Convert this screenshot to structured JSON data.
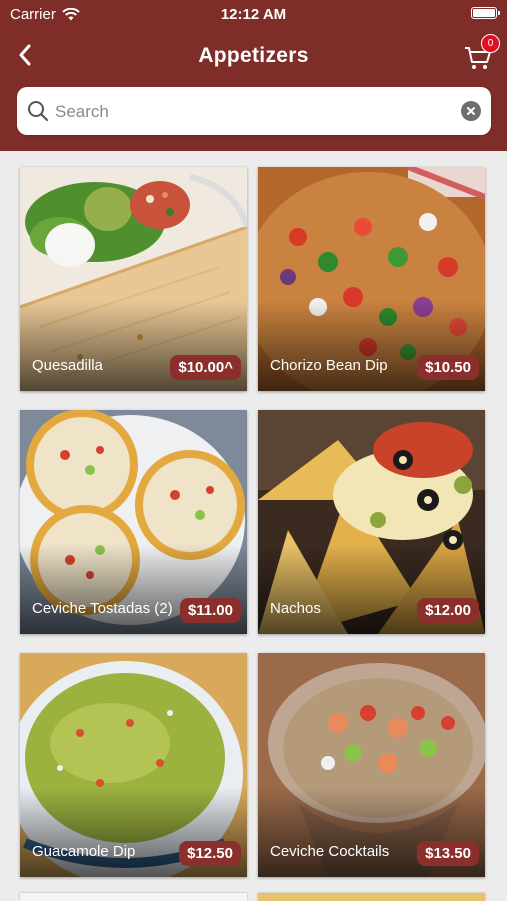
{
  "status_bar": {
    "carrier": "Carrier",
    "time": "12:12 AM"
  },
  "navbar": {
    "title": "Appetizers",
    "cart_count": "0"
  },
  "search": {
    "placeholder": "Search",
    "value": ""
  },
  "colors": {
    "brand": "#7f2d29",
    "price_tag": "#8a2f2b",
    "badge": "#e10f1f"
  },
  "items": [
    {
      "name": "Quesadilla",
      "price": "$10.00^"
    },
    {
      "name": "Chorizo Bean Dip",
      "price": "$10.50"
    },
    {
      "name": "Ceviche Tostadas (2)",
      "price": "$11.00"
    },
    {
      "name": "Nachos",
      "price": "$12.00"
    },
    {
      "name": "Guacamole Dip",
      "price": "$12.50"
    },
    {
      "name": "Ceviche Cocktails",
      "price": "$13.50"
    }
  ]
}
